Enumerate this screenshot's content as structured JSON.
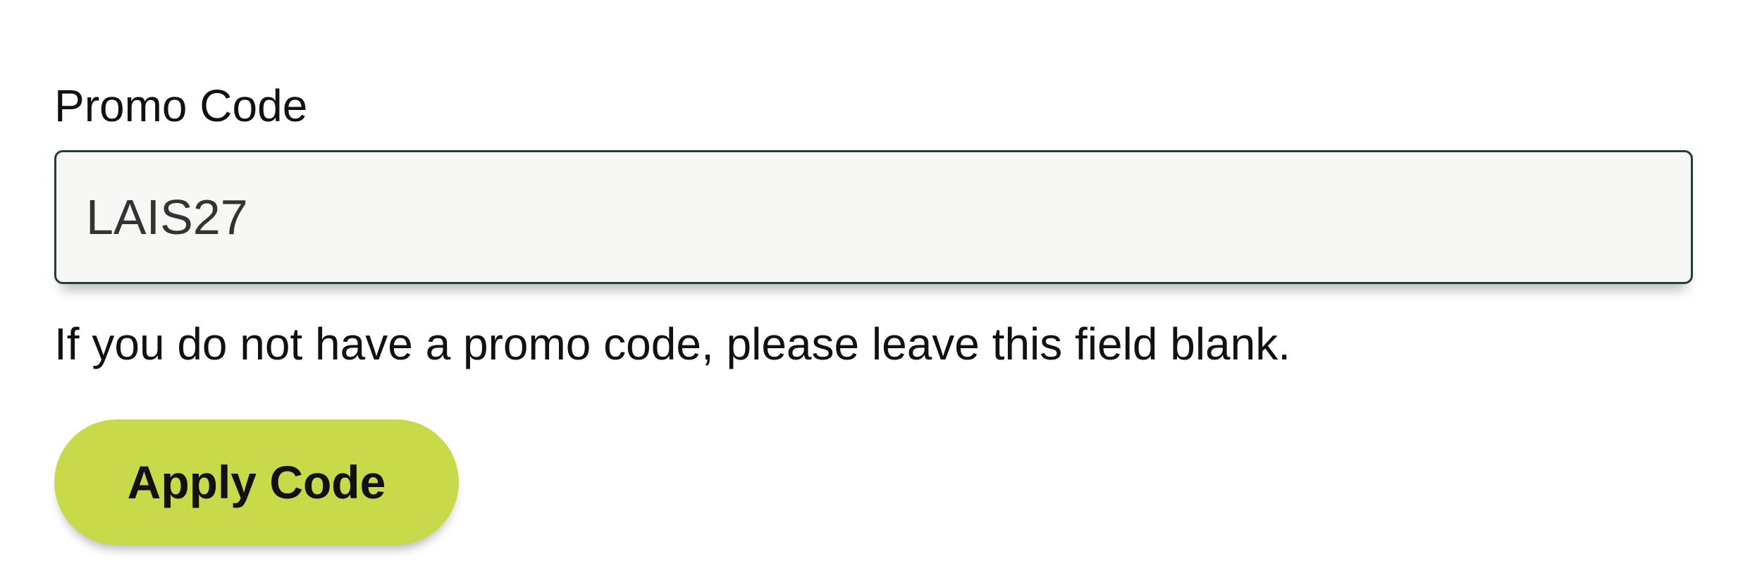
{
  "promo": {
    "label": "Promo Code",
    "input_value": "LAIS27",
    "help_text": "If you do not have a promo code, please leave this field blank.",
    "apply_label": "Apply Code"
  },
  "colors": {
    "button_bg": "#c8da4a",
    "input_border": "#243d35",
    "input_bg": "#f7f7f5",
    "text": "#111111"
  }
}
